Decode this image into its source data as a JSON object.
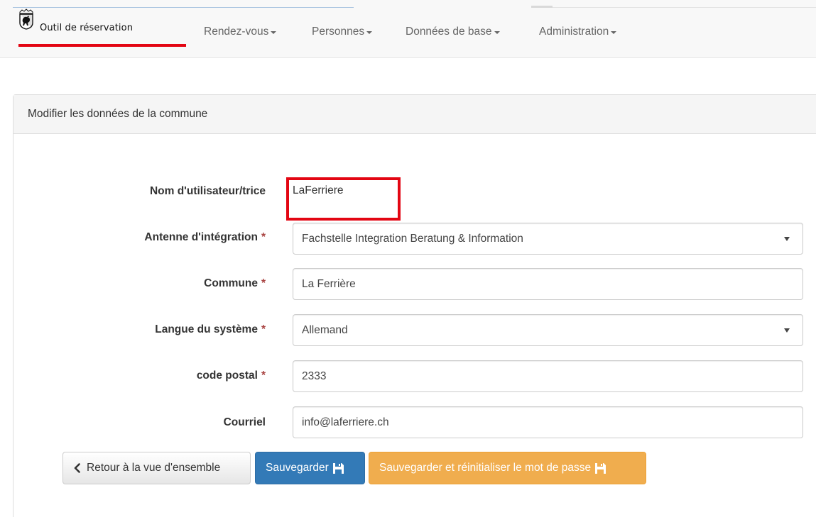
{
  "navbar": {
    "brand": "Outil de réservation",
    "items": [
      {
        "label": "Rendez-vous"
      },
      {
        "label": "Personnes"
      },
      {
        "label": "Données de base"
      },
      {
        "label": "Administration"
      }
    ],
    "brand_accent_color": "#e30613"
  },
  "panel": {
    "title": "Modifier les données de la commune"
  },
  "form": {
    "username_label": "Nom d'utilisateur/trice",
    "username_value": "LaFerriere",
    "antenne_label": "Antenne d'intégration",
    "antenne_value": "Fachstelle Integration Beratung & Information",
    "commune_label": "Commune",
    "commune_value": "La Ferrière",
    "langue_label": "Langue du système",
    "langue_value": "Allemand",
    "postal_label": "code postal",
    "postal_value": "2333",
    "email_label": "Courriel",
    "email_value": "info@laferriere.ch",
    "required_marker": "*"
  },
  "buttons": {
    "back_label": "Retour à la vue d'ensemble",
    "save_label": "Sauvegarder",
    "save_reset_label": "Sauvegarder et réinitialiser le mot de passe"
  },
  "colors": {
    "primary": "#337ab7",
    "warning": "#f0ad4e",
    "highlight": "#e30613",
    "required": "#a94442"
  },
  "icons": {
    "brand": "bern-bear-coat-of-arms-icon",
    "back": "chevron-left-icon",
    "save": "floppy-disk-icon",
    "dropdown": "caret-down-icon"
  }
}
